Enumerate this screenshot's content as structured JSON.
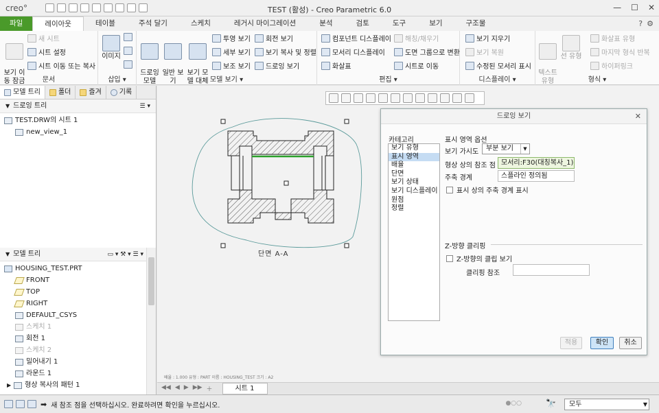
{
  "app": {
    "logo": "creo°",
    "window_title": "TEST (활성) - Creo Parametric 6.0",
    "window_controls": [
      "—",
      "☐",
      "✕"
    ]
  },
  "ribbon_tabs": [
    "파일",
    "레이아웃",
    "테이블",
    "주석 달기",
    "스케치",
    "레거시 마이그레이션",
    "분석",
    "검토",
    "도구",
    "보기",
    "구조물"
  ],
  "ribbon": {
    "document": {
      "label": "문서",
      "move_view": "보기 이\n동 잠금",
      "new_sheet": "새 시트",
      "sheet_setup": "시트 설정",
      "move_copy_sheet": "시트 이동 또는 복사"
    },
    "insert": {
      "label": "삽입",
      "image": "이미지"
    },
    "model_views": {
      "label": "모델 보기",
      "drawing_model": "드로잉\n모델",
      "general_view": "일반 보\n기",
      "view_model_replace": "보기 모\n델 대체",
      "projection_view": "투영 보기",
      "detail_view": "세부 보기",
      "auxiliary_view": "보조 보기",
      "revolved_view": "회전 보기",
      "copy_align_view": "보기 복사 및 정렬",
      "drawing_view": "드로잉 보기"
    },
    "edit": {
      "label": "편집",
      "component_display": "컴포넌트 디스플레이",
      "edge_display": "모서리 디스플레이",
      "arrows": "화살표",
      "hatch_fill": "해칭/채우기",
      "convert_to_group": "도면 그룹으로 변환",
      "move_to_sheet": "시트로 이동"
    },
    "display": {
      "label": "디스플레이",
      "erase_view": "보기 지우기",
      "resume_view": "보기 복원",
      "modified_edges": "수정된 모서리 표시"
    },
    "format": {
      "label": "형식",
      "text_style": "텍스트\n유형",
      "line_style": "선 유형",
      "hatch_style": "화살표 유형",
      "repeat_last_format": "마지막 형식 반복",
      "hyperlink": "하이퍼링크"
    }
  },
  "left_panel": {
    "tabs": [
      "모델 트리",
      "폴더",
      "즐겨",
      "기록"
    ],
    "drawing_tree": {
      "title": "드로잉 트리",
      "items": [
        "TEST.DRW의 시트 1",
        "new_view_1"
      ]
    },
    "model_tree": {
      "title": "모델 트리",
      "items": [
        {
          "label": "HOUSING_TEST.PRT",
          "dim": false
        },
        {
          "label": "FRONT",
          "dim": false
        },
        {
          "label": "TOP",
          "dim": false
        },
        {
          "label": "RIGHT",
          "dim": false
        },
        {
          "label": "DEFAULT_CSYS",
          "dim": false
        },
        {
          "label": "스케치 1",
          "dim": true
        },
        {
          "label": "회전 1",
          "dim": false
        },
        {
          "label": "스케치 2",
          "dim": true
        },
        {
          "label": "밀어내기 1",
          "dim": false
        },
        {
          "label": "라운드 1",
          "dim": false
        },
        {
          "label": "형상 복사의 패턴 1",
          "dim": false
        }
      ]
    }
  },
  "graphics": {
    "view_label": "단면 A-A",
    "sheet_info": "배율 : 1.000   유형 : PART   이름 : HOUSING_TEST   크기 : A2"
  },
  "sheet_tab": "시트 1",
  "status": {
    "message": "새 참조 점을 선택하십시오. 완료하려면 확인을 누르십시오.",
    "filter": "모두"
  },
  "dialog": {
    "title": "드로잉 보기",
    "close": "✕",
    "category_label": "카테고리",
    "categories": [
      "보기 유형",
      "표시 영역",
      "배율",
      "단면",
      "보기 상태",
      "보기 디스플레이",
      "원점",
      "정렬"
    ],
    "selected_category": "표시 영역",
    "options_title": "표시 영역 옵션",
    "visible_area_label": "보기 가시도",
    "visible_area_value": "부분 보기",
    "reference_point_label": "형상 상의 참조 점",
    "reference_point_value": "모서리:F30(대칭복사_1)",
    "boundary_label": "주축 경계",
    "boundary_value": "스플라인 정의됨",
    "show_boundary": "표시 상의 주축 경계 표시",
    "zclip_title": "Z-방향 클리핑",
    "zclip_checkbox": "Z-방향의 클립 보기",
    "clip_ref_label": "클리핑 참조",
    "buttons": {
      "apply": "적용",
      "ok": "확인",
      "cancel": "취소"
    }
  },
  "colors": {
    "file_tab": "#4a9a2a",
    "selection": "#c5dcf3",
    "reference_field": "#eef6e0",
    "boundary_spline": "#5a9a9a",
    "selected_edge": "#2aa02a"
  }
}
